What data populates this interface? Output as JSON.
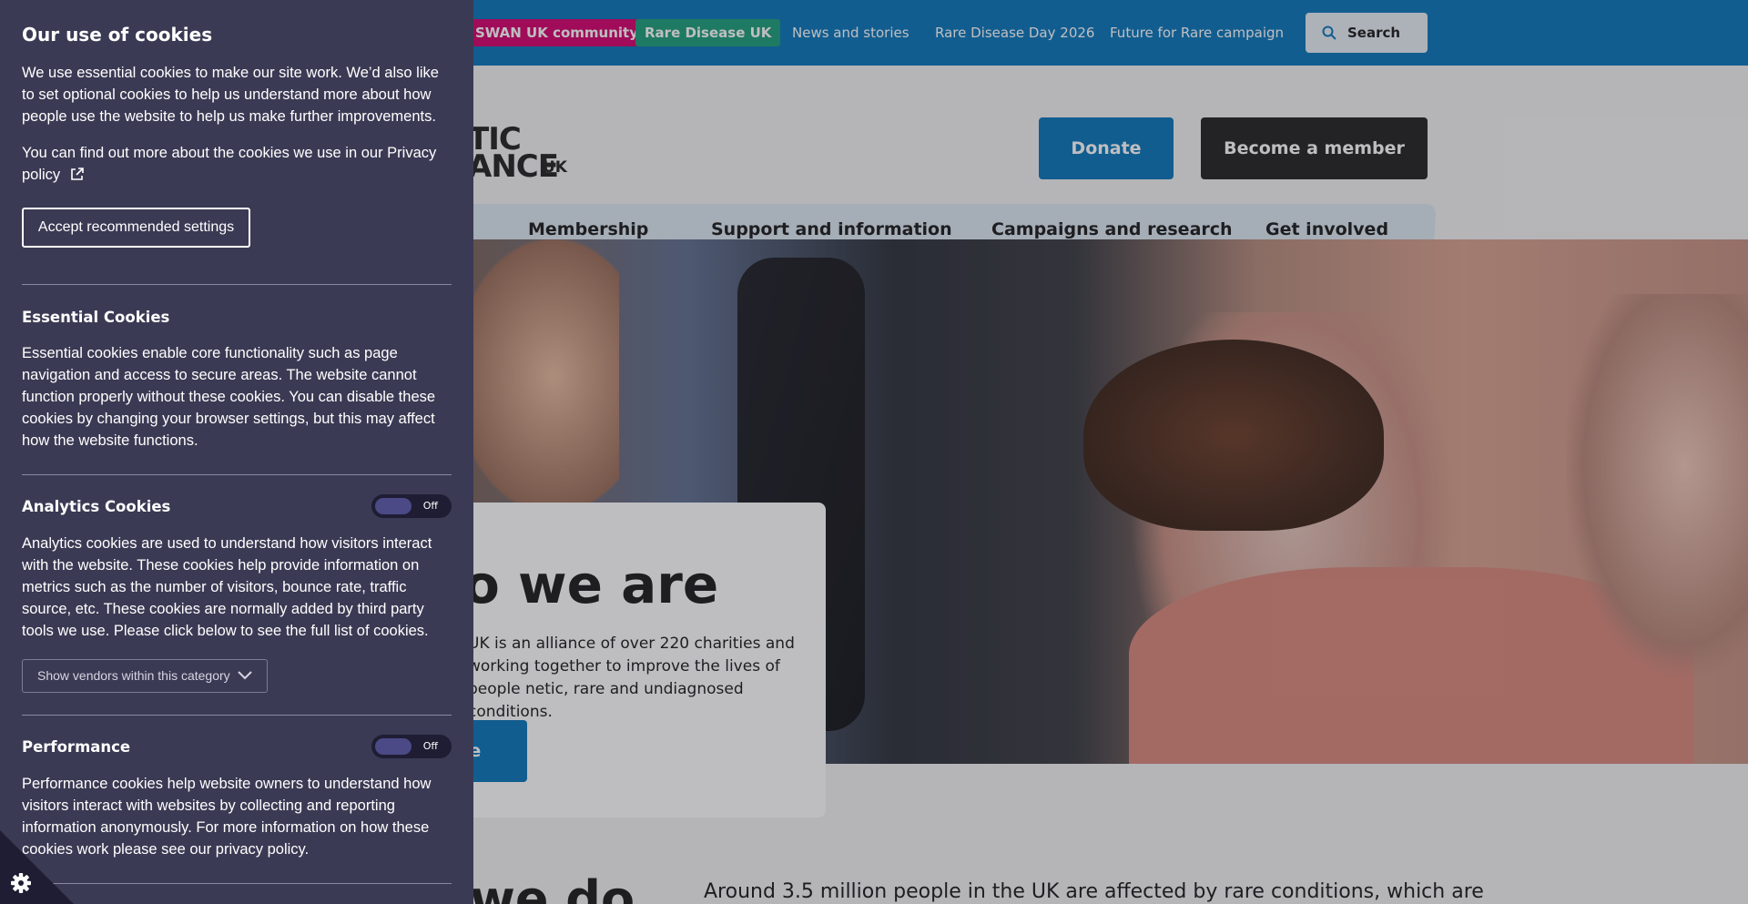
{
  "topbar": {
    "swan_label": "SWAN UK community",
    "rduk_label": "Rare Disease UK",
    "links": [
      "News and stories",
      "Rare Disease Day 2026",
      "Future for Rare campaign"
    ],
    "search_label": "Search"
  },
  "header": {
    "logo_line1": "TIC",
    "logo_line2": "ANCE",
    "logo_uk": "UK",
    "donate_label": "Donate",
    "member_label": "Become a member"
  },
  "nav": {
    "items": [
      "Membership",
      "Support and information",
      "Campaigns and research",
      "Get involved"
    ]
  },
  "hero": {
    "title": "o we are",
    "text": "UK is an alliance of over 220 charities and working together to improve the lives of people netic, rare and undiagnosed conditions.",
    "button_label": "re"
  },
  "lower": {
    "title": "we do",
    "text": "Around 3.5 million people in the UK are affected by rare conditions, which are"
  },
  "cookie": {
    "title": "Our use of cookies",
    "intro": "We use essential cookies to make our site work. We’d also like to set optional cookies to help us understand more about how people use the website to help us make further improvements.",
    "privacy_text": "You can find out more about the cookies we use in our Privacy policy",
    "accept_label": "Accept recommended settings",
    "essential": {
      "heading": "Essential Cookies",
      "text": "Essential cookies enable core functionality such as page navigation and access to secure areas. The website cannot function properly without these cookies. You can disable these cookies by changing your browser settings, but this may affect how the website functions."
    },
    "analytics": {
      "heading": "Analytics Cookies",
      "toggle_label": "Off",
      "text": "Analytics cookies are used to understand how visitors interact with the website. These cookies help provide information on metrics such as the number of visitors, bounce rate, traffic source, etc. These cookies are normally added by third party tools we use. Please click below to see the full list of cookies.",
      "vendors_label": "Show vendors within this category"
    },
    "performance": {
      "heading": "Performance",
      "toggle_label": "Off",
      "text": "Performance cookies help website owners to understand how visitors interact with websites by collecting and reporting information anonymously. For more information on how these cookies work please see our privacy policy."
    }
  },
  "colors": {
    "brand_blue": "#0a75b8",
    "swan_pink": "#d4006a",
    "rduk_green": "#1b9e77",
    "cookie_panel": "#3b3a54"
  }
}
